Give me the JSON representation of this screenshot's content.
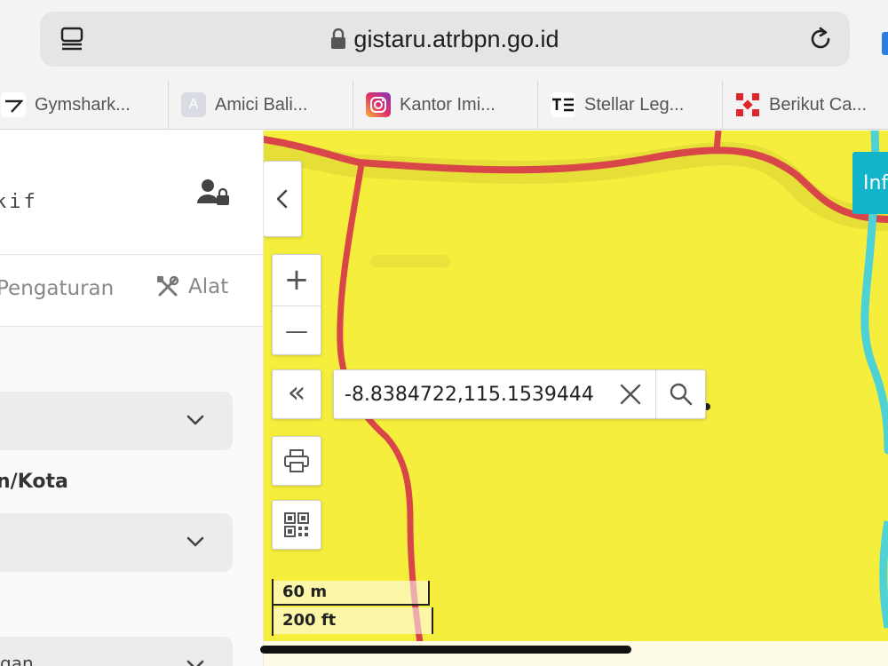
{
  "browser": {
    "url": "gistaru.atrbpn.go.id",
    "bookmarks": [
      {
        "label": "Gymshark...",
        "icon": "gymshark-icon"
      },
      {
        "label": "Amici Bali...",
        "icon": "letter-a-icon",
        "icon_text": "A"
      },
      {
        "label": "Kantor Imi...",
        "icon": "instagram-icon"
      },
      {
        "label": "Stellar Leg...",
        "icon": "stellar-icon"
      },
      {
        "label": "Berikut Ca...",
        "icon": "berikut-icon"
      }
    ]
  },
  "panel": {
    "header_text": "kif",
    "menu": {
      "settings_label": "Pengaturan",
      "tools_label": "Alat"
    },
    "field_label": "n/Kota",
    "partial_bottom_text": "gan"
  },
  "map": {
    "search": {
      "value": "-8.8384722,115.1539444"
    },
    "zoom_in_label": "+",
    "zoom_out_label": "—",
    "expand_label": "«",
    "info_label": "Inf",
    "scale": {
      "metric": "60 m",
      "imperial": "200 ft"
    }
  },
  "colors": {
    "map_fill": "#f6ee3c",
    "road": "#d9464a",
    "river": "#4fd2d6",
    "info_accent": "#12b4c9"
  }
}
